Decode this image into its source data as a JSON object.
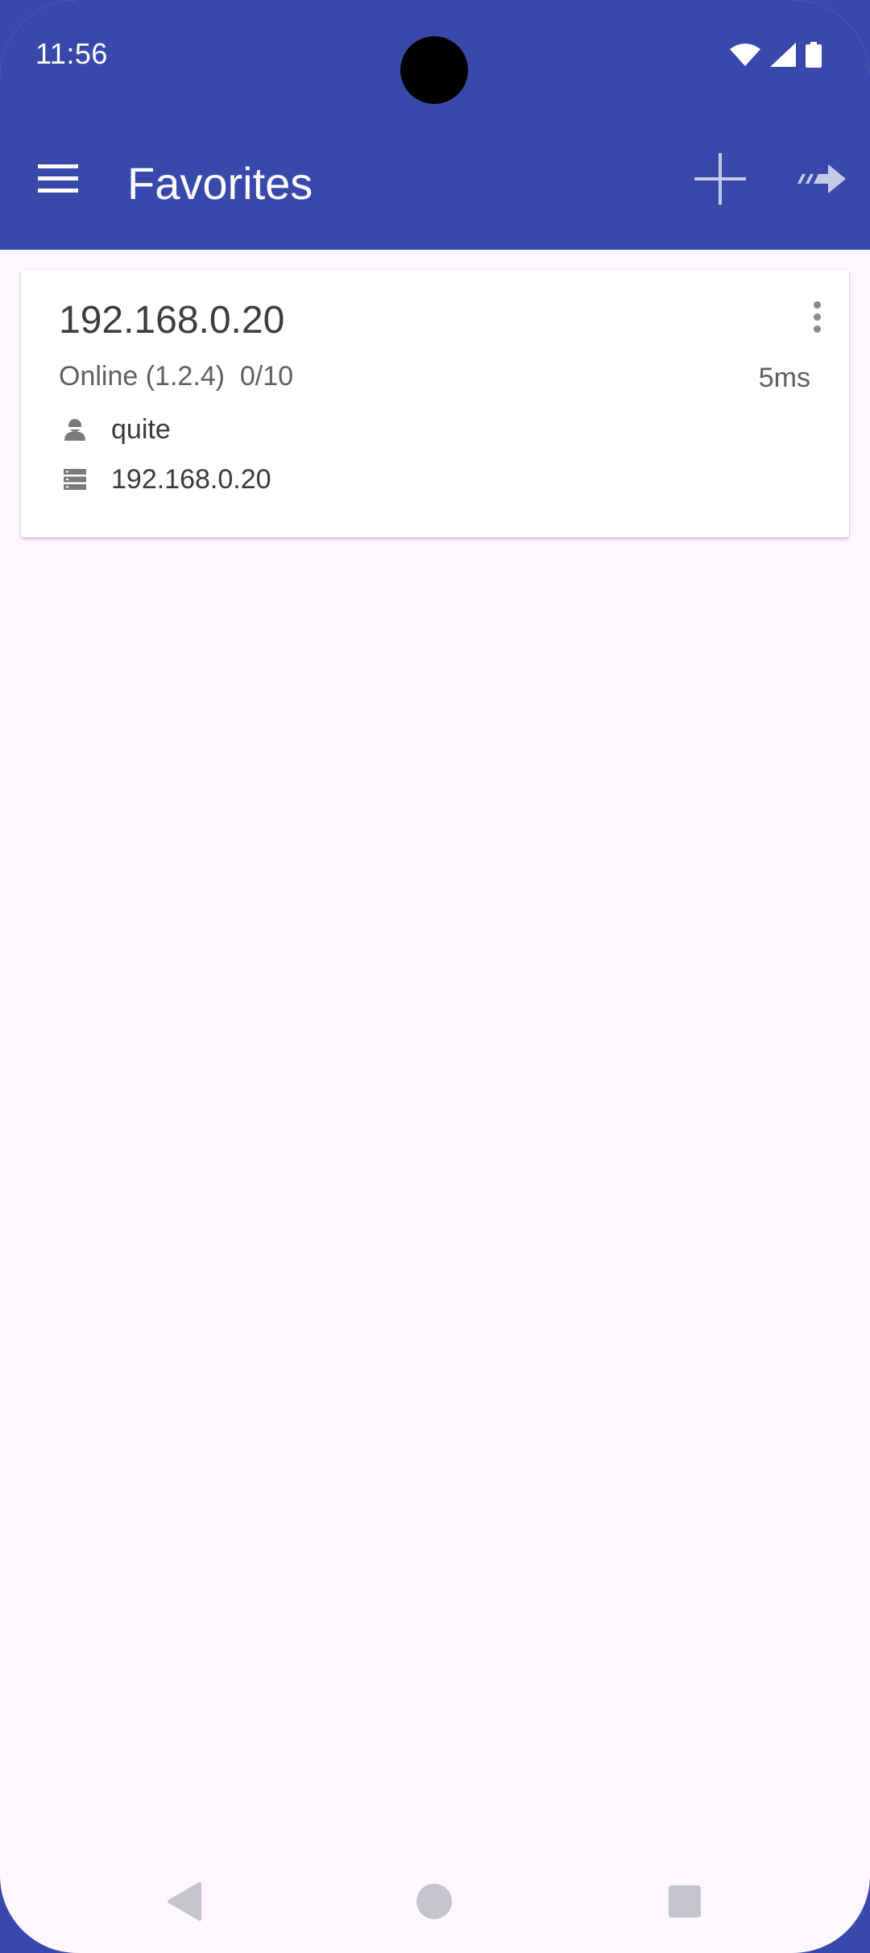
{
  "status_bar": {
    "time": "11:56",
    "icons": [
      "wifi-icon",
      "cellular-signal-icon",
      "battery-icon"
    ]
  },
  "app_bar": {
    "title": "Favorites",
    "background_color": "#3949ab",
    "actions": [
      "menu-icon",
      "add-icon",
      "forward-icon"
    ]
  },
  "favorites": [
    {
      "name": "192.168.0.20",
      "status": "Online (1.2.4)  0/10",
      "ping": "5ms",
      "user": "quite",
      "server": "192.168.0.20"
    }
  ],
  "colors": {
    "page_background": "#fdf7fe",
    "card_background": "#ffffff",
    "nav_icon": "#c4c4cc"
  },
  "nav_bar": {
    "buttons": [
      "back-icon",
      "home-icon",
      "recents-icon"
    ]
  }
}
